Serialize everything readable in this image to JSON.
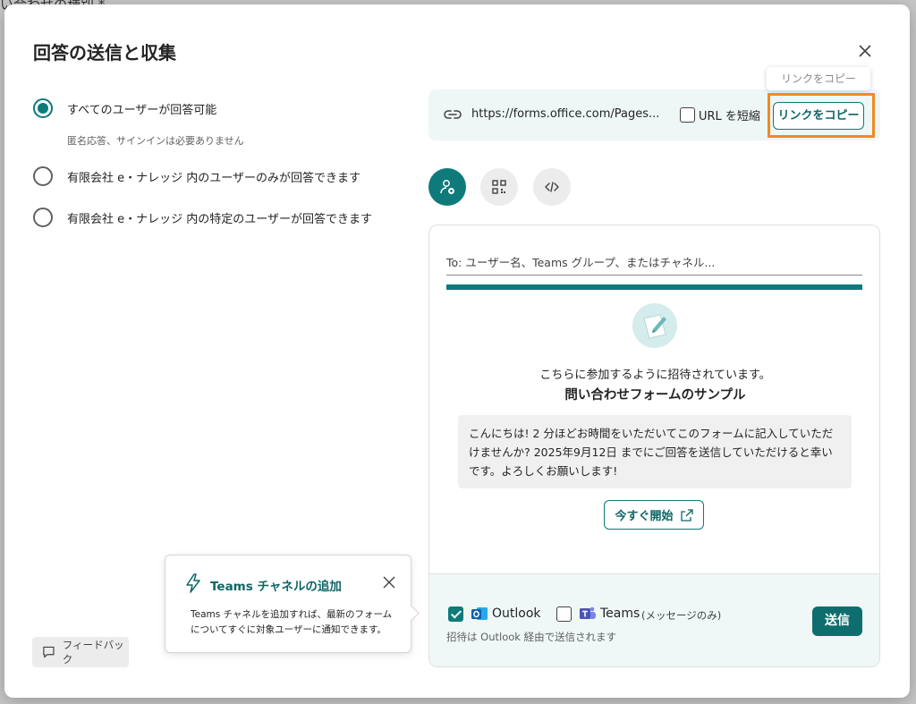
{
  "background": {
    "fragment_text": "い合わせの種別 *"
  },
  "dialog": {
    "title": "回答の送信と収集",
    "close_icon": "close-icon"
  },
  "audience": {
    "options": [
      {
        "label": "すべてのユーザーが回答可能",
        "selected": true,
        "sub": "匿名応答、サインインは必要ありません"
      },
      {
        "label": "有限会社 e・ナレッジ 内のユーザーのみが回答できます",
        "selected": false
      },
      {
        "label": "有限会社 e・ナレッジ 内の特定のユーザーが回答できます",
        "selected": false
      }
    ]
  },
  "link": {
    "url": "https://forms.office.com/Pages...",
    "shorten_label": "URL を短縮",
    "shorten_checked": false,
    "copy_button": "リンクをコピー",
    "tooltip": "リンクをコピー"
  },
  "share_tabs": [
    {
      "name": "invite-people-icon",
      "active": true
    },
    {
      "name": "qr-code-icon",
      "active": false
    },
    {
      "name": "embed-code-icon",
      "active": false
    }
  ],
  "invite": {
    "to_placeholder": "To: ユーザー名、Teams グループ、またはチャネル...",
    "invited_text": "こちらに参加するように招待されています。",
    "form_name": "問い合わせフォームのサンプル",
    "message": "こんにちは! 2 分ほどお時間をいただいてこのフォームに記入していただけませんか? 2025年9月12日 までにご回答を送信していただけると幸いです。よろしくお願いします!",
    "start_button": "今すぐ開始",
    "channels": {
      "outlook_label": "Outlook",
      "outlook_checked": true,
      "teams_label": "Teams",
      "teams_suffix": "(メッセージのみ)",
      "teams_checked": false
    },
    "note": "招待は Outlook 経由で送信されます",
    "send_button": "送信"
  },
  "callout": {
    "title": "Teams チャネルの追加",
    "body": "Teams チャネルを追加すれば、最新のフォームについてすぐに対象ユーザーに通知できます。"
  },
  "feedback": {
    "label": "フィードバック"
  },
  "colors": {
    "accent": "#0e7a7a",
    "highlight": "#f08a24"
  }
}
